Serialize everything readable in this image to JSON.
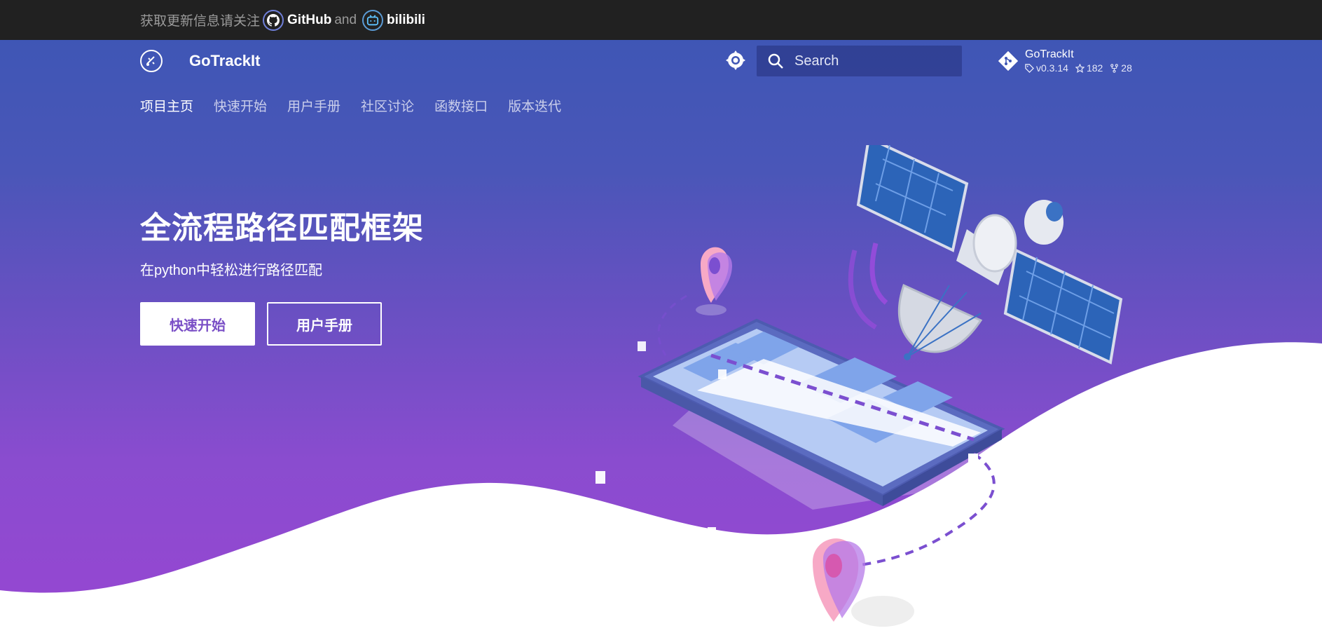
{
  "announcement": {
    "text": "获取更新信息请关注",
    "github_label": "GitHub",
    "and_text": "and",
    "bilibili_label": "bilibili"
  },
  "header": {
    "title": "GoTrackIt",
    "search_placeholder": "Search"
  },
  "repo": {
    "name": "GoTrackIt",
    "version": "v0.3.14",
    "stars": "182",
    "forks": "28"
  },
  "tabs": [
    {
      "label": "项目主页",
      "active": true
    },
    {
      "label": "快速开始",
      "active": false
    },
    {
      "label": "用户手册",
      "active": false
    },
    {
      "label": "社区讨论",
      "active": false
    },
    {
      "label": "函数接口",
      "active": false
    },
    {
      "label": "版本迭代",
      "active": false
    }
  ],
  "hero": {
    "headline": "全流程路径匹配框架",
    "subtitle": "在python中轻松进行路径匹配",
    "primary_button": "快速开始",
    "secondary_button": "用户手册"
  },
  "colors": {
    "announce_bg": "#212121",
    "hero_top": "#3f56b5",
    "hero_bottom": "#9746d2",
    "accent": "#7a4fc6"
  },
  "icons": [
    "github-icon",
    "bilibili-icon",
    "site-logo-icon",
    "brightness-icon",
    "search-icon",
    "git-icon",
    "tag-icon",
    "star-icon",
    "fork-icon"
  ]
}
